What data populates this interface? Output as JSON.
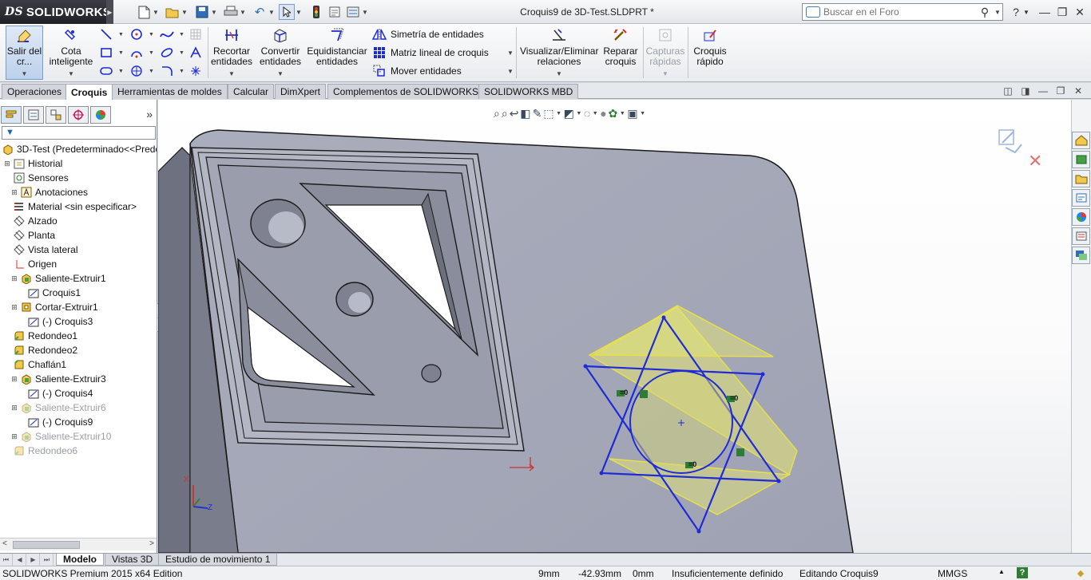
{
  "app": {
    "logo_mark": "DS",
    "logo_name": "SOLIDWORKS",
    "doc_title": "Croquis9 de 3D-Test.SLDPRT *"
  },
  "search": {
    "placeholder": "Buscar en el Foro"
  },
  "commands": {
    "exit_sketch": "Salir del cr...",
    "smart_dimension": "Cota inteligente",
    "trim": "Recortar entidades",
    "convert": "Convertir entidades",
    "offset": "Equidistanciar entidades",
    "mirror": "Simetría de entidades",
    "linear_pattern": "Matriz lineal de croquis",
    "move": "Mover entidades",
    "display_relations": "Visualizar/Eliminar relaciones",
    "repair": "Reparar croquis",
    "quick_snaps": "Capturas rápidas",
    "rapid_sketch": "Croquis rápido"
  },
  "tabs": [
    "Operaciones",
    "Croquis",
    "Herramientas de moldes",
    "Calcular",
    "DimXpert",
    "Complementos de SOLIDWORKS",
    "SOLIDWORKS MBD"
  ],
  "tabs_active": 1,
  "tree": {
    "root": "3D-Test  (Predeterminado<<Predeterm",
    "items": [
      {
        "label": "Historial",
        "icon": "history-icon"
      },
      {
        "label": "Sensores",
        "icon": "sensor-icon"
      },
      {
        "label": "Anotaciones",
        "icon": "annotation-icon"
      },
      {
        "label": "Material <sin especificar>",
        "icon": "material-icon"
      },
      {
        "label": "Alzado",
        "icon": "plane-icon"
      },
      {
        "label": "Planta",
        "icon": "plane-icon"
      },
      {
        "label": "Vista lateral",
        "icon": "plane-icon"
      },
      {
        "label": "Origen",
        "icon": "origin-icon"
      },
      {
        "label": "Saliente-Extruir1",
        "icon": "extrude-boss-icon"
      },
      {
        "label": "Croquis1",
        "icon": "sketch-icon"
      },
      {
        "label": "Cortar-Extruir1",
        "icon": "extrude-cut-icon"
      },
      {
        "label": "(-) Croquis3",
        "icon": "sketch-icon"
      },
      {
        "label": "Redondeo1",
        "icon": "fillet-icon"
      },
      {
        "label": "Redondeo2",
        "icon": "fillet-icon"
      },
      {
        "label": "Chaflán1",
        "icon": "chamfer-icon"
      },
      {
        "label": "Saliente-Extruir3",
        "icon": "extrude-boss-icon"
      },
      {
        "label": "(-) Croquis4",
        "icon": "sketch-icon"
      },
      {
        "label": "Saliente-Extruir6",
        "icon": "extrude-boss-icon"
      },
      {
        "label": "(-) Croquis9",
        "icon": "sketch-icon"
      },
      {
        "label": "Saliente-Extruir10",
        "icon": "extrude-boss-icon"
      },
      {
        "label": "Redondeo6",
        "icon": "fillet-icon"
      }
    ]
  },
  "bottom_tabs": [
    "Modelo",
    "Vistas 3D",
    "Estudio de movimiento 1"
  ],
  "status": {
    "edition": "SOLIDWORKS Premium 2015 x64 Edition",
    "x": "9mm",
    "y": "-42.93mm",
    "z": "0mm",
    "definition": "Insuficientemente definido",
    "editing": "Editando Croquis9",
    "units": "MMGS"
  },
  "triad": {
    "x": "X",
    "y": "Y",
    "z": "Z"
  },
  "relation_labels": [
    "=0",
    "=0",
    "=0"
  ],
  "colors": {
    "part_face": "#a7abb9",
    "sketch_line": "#1f2bd6",
    "preview_fill": "#e6e573",
    "accent_blue": "#3d7fc1"
  }
}
